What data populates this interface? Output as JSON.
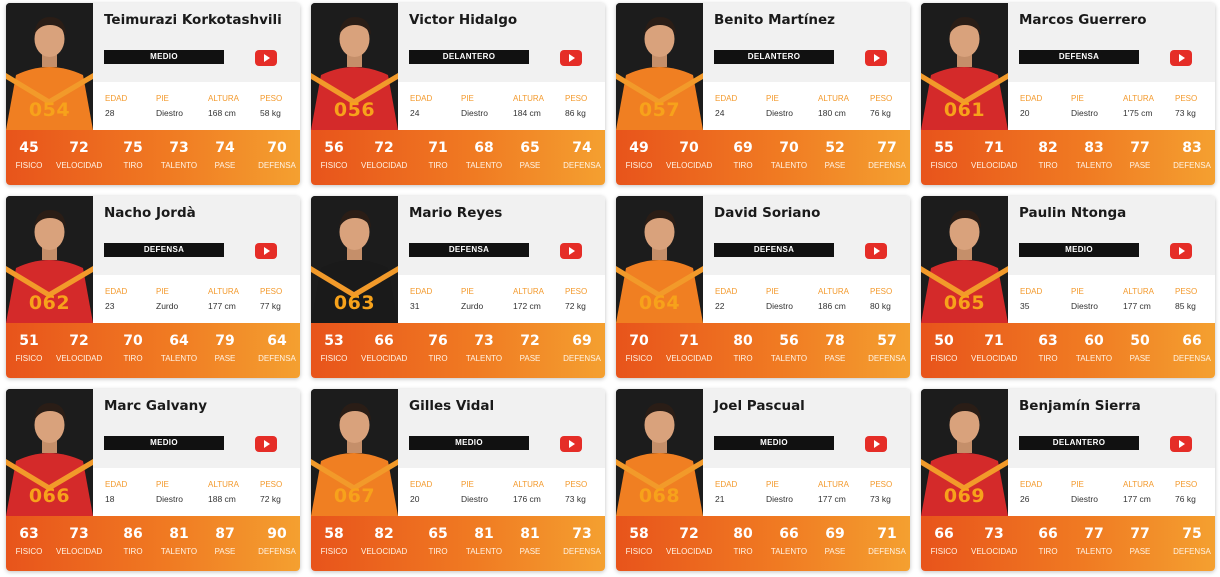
{
  "labels": {
    "edad": "EDAD",
    "pie": "PIE",
    "altura": "ALTURA",
    "peso": "PESO",
    "fisico": "FISICO",
    "velocidad": "VELOCIDAD",
    "tiro": "TIRO",
    "talento": "TALENTO",
    "pase": "PASE",
    "defensa": "DEFENSA"
  },
  "colors": {
    "accent": "#f39a2d",
    "stats_start": "#e8541b",
    "stats_end": "#f4a030",
    "youtube": "#e52d27"
  },
  "players": [
    {
      "name": "Teimurazi Korkotashvili",
      "number": "054",
      "position": "MEDIO",
      "edad": "28",
      "pie": "Diestro",
      "altura": "168 cm",
      "peso": "58 kg",
      "stats": [
        "45",
        "72",
        "75",
        "73",
        "74",
        "70"
      ]
    },
    {
      "name": "Victor Hidalgo",
      "number": "056",
      "position": "DELANTERO",
      "edad": "24",
      "pie": "Diestro",
      "altura": "184 cm",
      "peso": "86 kg",
      "stats": [
        "56",
        "72",
        "71",
        "68",
        "65",
        "74"
      ]
    },
    {
      "name": "Benito Martínez",
      "number": "057",
      "position": "DELANTERO",
      "edad": "24",
      "pie": "Diestro",
      "altura": "180 cm",
      "peso": "76 kg",
      "stats": [
        "49",
        "70",
        "69",
        "70",
        "52",
        "77"
      ]
    },
    {
      "name": "Marcos Guerrero",
      "number": "061",
      "position": "DEFENSA",
      "edad": "20",
      "pie": "Diestro",
      "altura": "1'75 cm",
      "peso": "73 kg",
      "stats": [
        "55",
        "71",
        "82",
        "83",
        "77",
        "83"
      ]
    },
    {
      "name": "Nacho Jordà",
      "number": "062",
      "position": "DEFENSA",
      "edad": "23",
      "pie": "Zurdo",
      "altura": "177 cm",
      "peso": "77 kg",
      "stats": [
        "51",
        "72",
        "70",
        "64",
        "79",
        "64"
      ]
    },
    {
      "name": "Mario Reyes",
      "number": "063",
      "position": "DEFENSA",
      "edad": "31",
      "pie": "Zurdo",
      "altura": "172 cm",
      "peso": "72 kg",
      "stats": [
        "53",
        "66",
        "76",
        "73",
        "72",
        "69"
      ]
    },
    {
      "name": "David Soriano",
      "number": "064",
      "position": "DEFENSA",
      "edad": "22",
      "pie": "Diestro",
      "altura": "186 cm",
      "peso": "80 kg",
      "stats": [
        "70",
        "71",
        "80",
        "56",
        "78",
        "57"
      ]
    },
    {
      "name": "Paulin Ntonga",
      "number": "065",
      "position": "MEDIO",
      "edad": "35",
      "pie": "Diestro",
      "altura": "177 cm",
      "peso": "85 kg",
      "stats": [
        "50",
        "71",
        "63",
        "60",
        "50",
        "66"
      ]
    },
    {
      "name": "Marc Galvany",
      "number": "066",
      "position": "MEDIO",
      "edad": "18",
      "pie": "Diestro",
      "altura": "188 cm",
      "peso": "72 kg",
      "stats": [
        "63",
        "73",
        "86",
        "81",
        "87",
        "90"
      ]
    },
    {
      "name": "Gilles Vidal",
      "number": "067",
      "position": "MEDIO",
      "edad": "20",
      "pie": "Diestro",
      "altura": "176 cm",
      "peso": "73 kg",
      "stats": [
        "58",
        "82",
        "65",
        "81",
        "81",
        "73"
      ]
    },
    {
      "name": "Joel Pascual",
      "number": "068",
      "position": "MEDIO",
      "edad": "21",
      "pie": "Diestro",
      "altura": "177 cm",
      "peso": "73 kg",
      "stats": [
        "58",
        "72",
        "80",
        "66",
        "69",
        "71"
      ]
    },
    {
      "name": "Benjamín Sierra",
      "number": "069",
      "position": "DELANTERO",
      "edad": "26",
      "pie": "Diestro",
      "altura": "177 cm",
      "peso": "76 kg",
      "stats": [
        "66",
        "73",
        "66",
        "77",
        "77",
        "75"
      ]
    }
  ]
}
